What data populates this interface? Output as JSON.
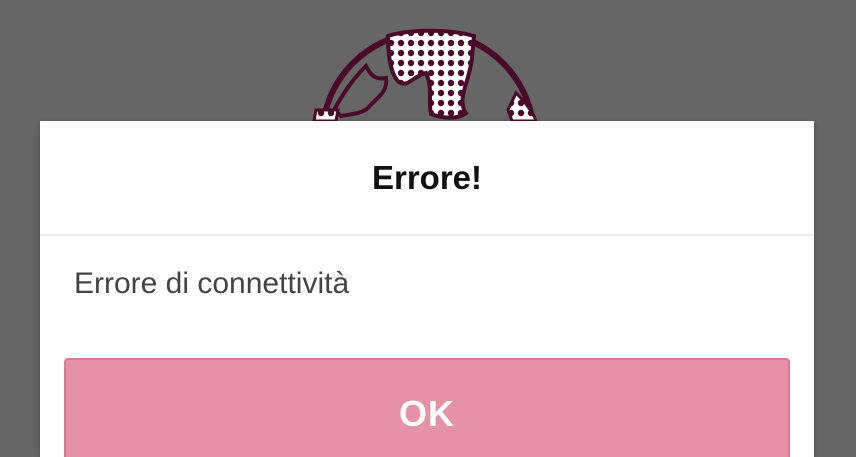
{
  "dialog": {
    "title": "Errore!",
    "message": "Errore di connettività",
    "ok_label": "OK"
  },
  "background": {
    "logo_icon": "world-globe-icon"
  },
  "colors": {
    "overlay": "#666666",
    "dialog_bg": "#ffffff",
    "title": "#111111",
    "message": "#444444",
    "button_bg": "#e591a6",
    "button_text": "#ffffff",
    "logo": "#4a0a2a"
  }
}
